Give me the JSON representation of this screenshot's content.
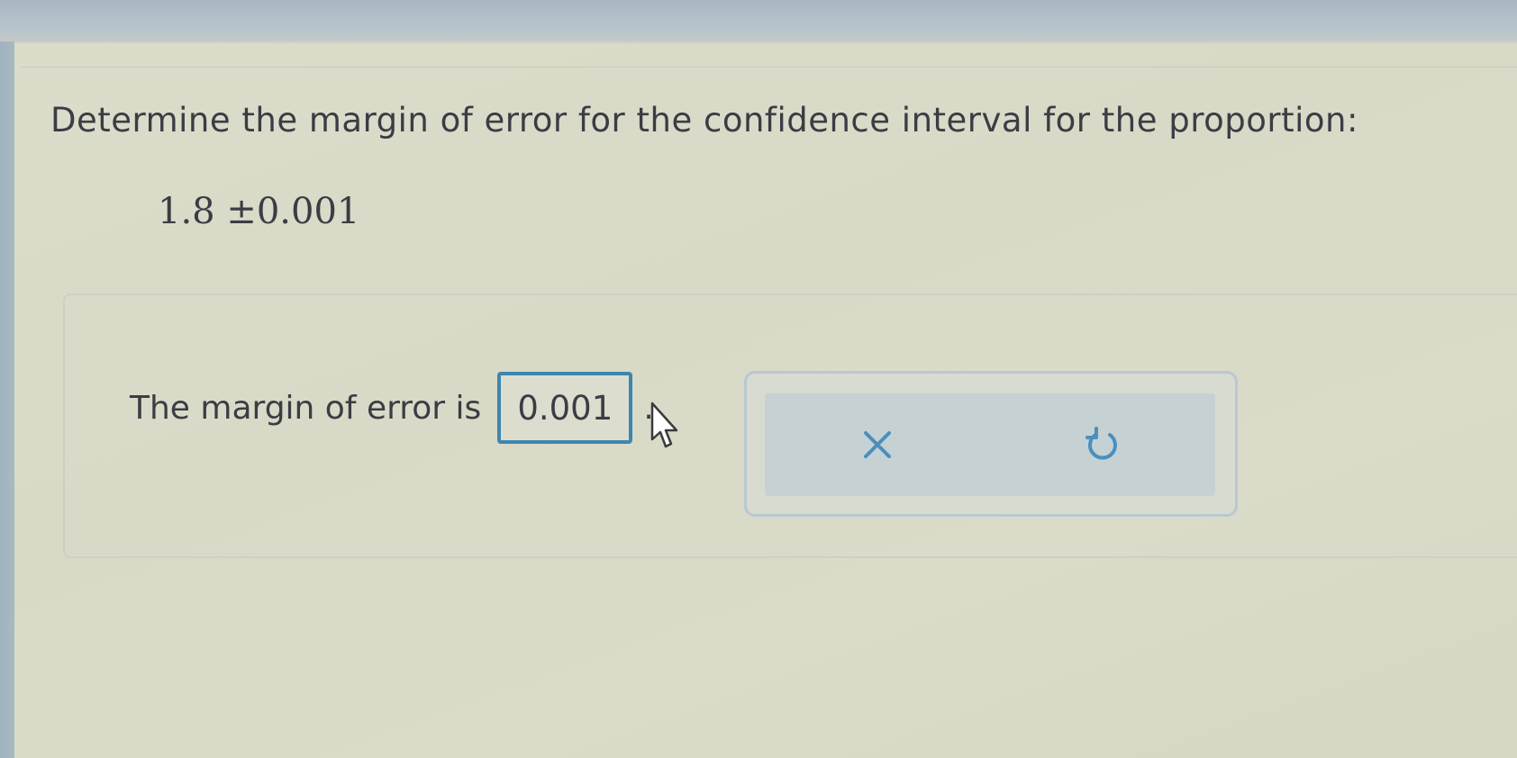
{
  "question": {
    "prompt": "Determine the margin of error for the confidence interval for the proportion:",
    "expression": "1.8 ±0.001"
  },
  "answer": {
    "label": "The margin of error is",
    "value": "0.001",
    "suffix": "."
  },
  "actions": {
    "clear_icon": "close-icon",
    "reset_icon": "undo-icon"
  },
  "colors": {
    "accent": "#3f86ad",
    "icon": "#4a8fbe"
  }
}
